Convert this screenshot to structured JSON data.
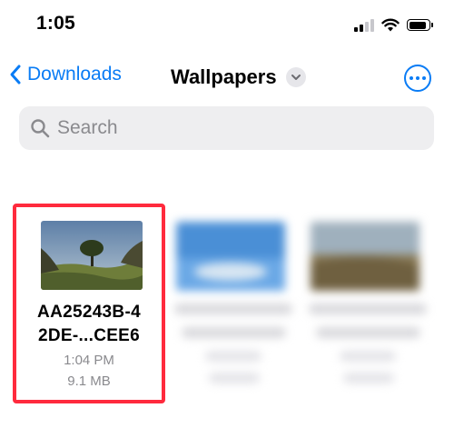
{
  "status_bar": {
    "time": "1:05",
    "icons": [
      "cellular-signal-icon",
      "wifi-icon",
      "battery-icon"
    ],
    "battery_level": 0.85
  },
  "nav": {
    "back_label": "Downloads",
    "title": "Wallpapers",
    "more_icon": "ellipsis-circle-icon",
    "accent_color": "#0a7cf5"
  },
  "search": {
    "placeholder": "Search"
  },
  "files": [
    {
      "name_line1": "AA25243B-4",
      "name_line2": "2DE-...CEE6",
      "time": "1:04 PM",
      "size": "9.1 MB",
      "selected": true,
      "highlight_color": "#ff2a3d"
    },
    {
      "blurred": true
    },
    {
      "blurred": true
    }
  ]
}
